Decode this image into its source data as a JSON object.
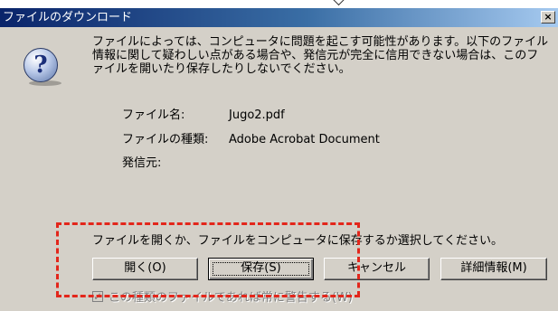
{
  "dialog": {
    "title": "ファイルのダウンロード",
    "close_label": "×",
    "warning": "ファイルによっては、コンピュータに問題を起こす可能性があります。以下のファイル情報に関して疑わしい点がある場合や、発信元が完全に信用できない場合は、このファイルを開いたり保存したりしないでください。",
    "file_info": [
      {
        "label": "ファイル名:",
        "value": "Jugo2.pdf"
      },
      {
        "label": "ファイルの種類:",
        "value": "Adobe Acrobat Document"
      },
      {
        "label": "発信元:",
        "value": ""
      }
    ],
    "prompt": "ファイルを開くか、ファイルをコンピュータに保存するか選択してください。",
    "buttons": {
      "open": "開く(O)",
      "save": "保存(S)",
      "cancel": "キャンセル",
      "details": "詳細情報(M)"
    },
    "checkbox_label": "この種類のファイルであれば常に警告する(W)",
    "checkbox_checked": true
  },
  "icons": {
    "question": "question-icon",
    "close": "close-icon",
    "checkbox_tick": "check-icon"
  },
  "colors": {
    "title_gradient_start": "#0a246a",
    "title_gradient_end": "#a6caf0",
    "dialog_face": "#d4d0c8",
    "annotation": "#e3261b"
  }
}
